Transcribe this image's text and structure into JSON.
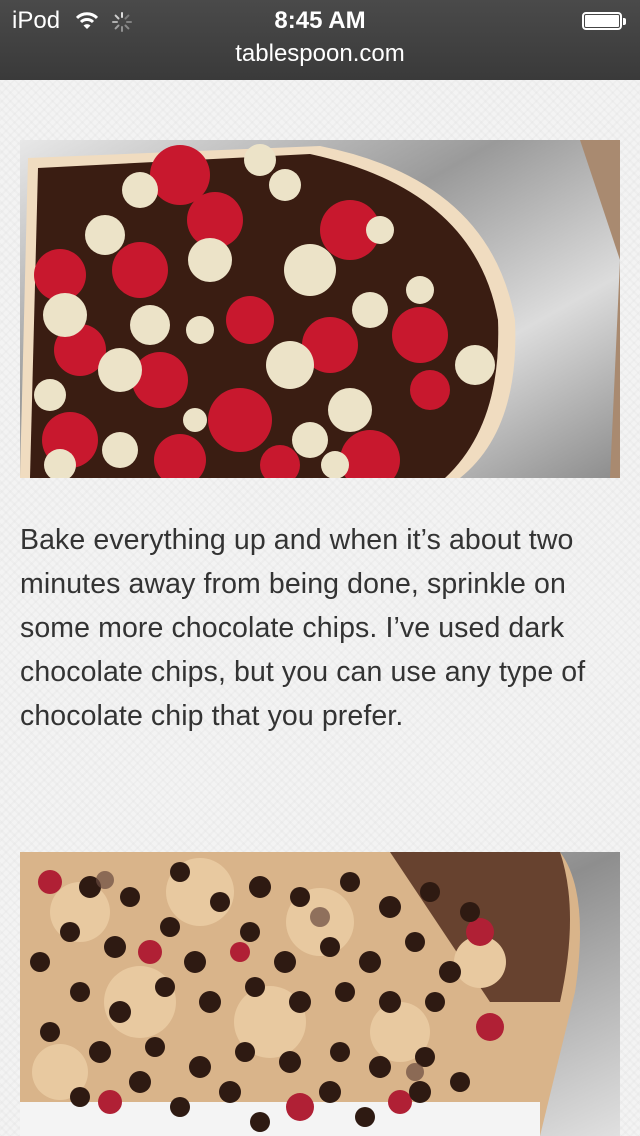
{
  "status_bar": {
    "carrier": "iPod",
    "time": "8:45 AM",
    "url": "tablespoon.com"
  },
  "icons": {
    "wifi": "wifi-icon",
    "loading": "activity-spinner-icon",
    "battery": "battery-icon"
  },
  "article": {
    "paragraph": "Bake everything up and when it’s about two minutes away from being done, sprinkle on some more chocolate chips. I’ve used dark chocolate chips, but you can use any type of chocolate chip that you prefer."
  }
}
